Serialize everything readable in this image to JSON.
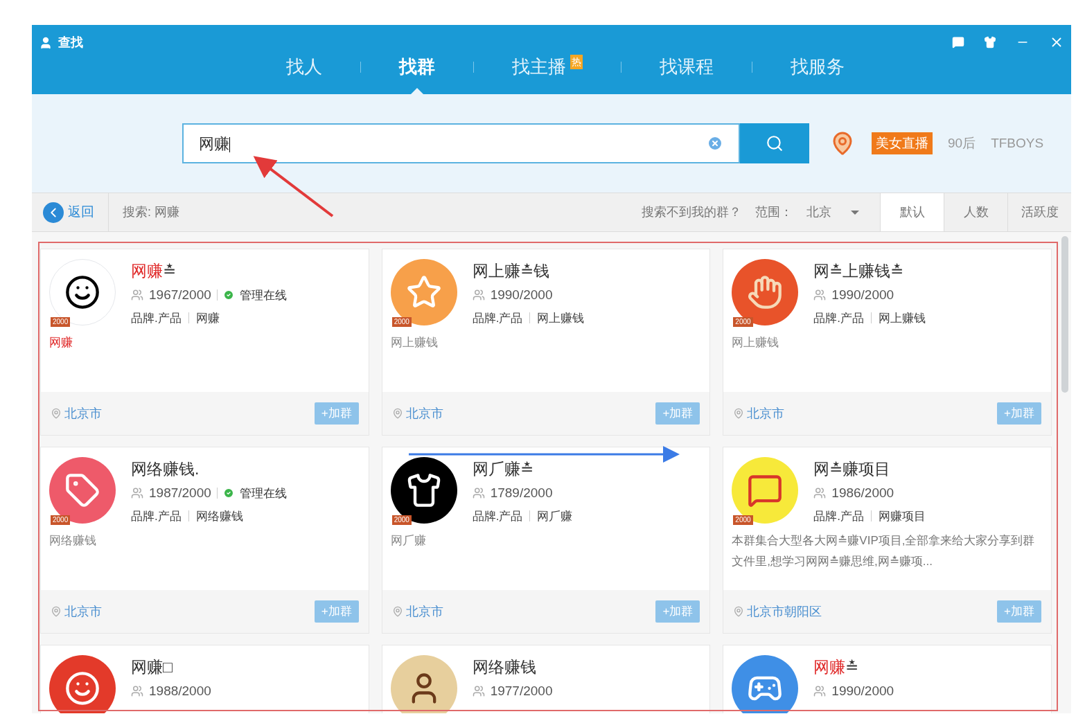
{
  "window": {
    "title": "查找"
  },
  "nav_tabs": [
    {
      "label": "找人",
      "selected": false
    },
    {
      "label": "找群",
      "selected": true
    },
    {
      "label": "找主播",
      "selected": false,
      "badge": "热"
    },
    {
      "label": "找课程",
      "selected": false
    },
    {
      "label": "找服务",
      "selected": false
    }
  ],
  "search": {
    "value": "网赚"
  },
  "hot_tags": [
    {
      "label": "美女直播",
      "kind": "highlight"
    },
    {
      "label": "90后",
      "kind": "plain"
    },
    {
      "label": "TFBOYS",
      "kind": "plain"
    }
  ],
  "toolbar": {
    "back": "返回",
    "query": "搜索: 网赚",
    "not_found": "搜索不到我的群？",
    "range_label": "范围：",
    "range_value": "北京",
    "sort_tabs": [
      {
        "label": "默认",
        "selected": true
      },
      {
        "label": "人数",
        "selected": false
      },
      {
        "label": "活跃度",
        "selected": false
      }
    ]
  },
  "groups": [
    {
      "kind": "panda",
      "level_badge": "2000",
      "name_parts": [
        {
          "text": "网赚",
          "match": true
        },
        {
          "text": "≛",
          "match": false
        }
      ],
      "members": "1967/2000",
      "admin_status": "管理在线",
      "tags": [
        "品牌.产品",
        "网赚"
      ],
      "keyword_parts": [
        {
          "text": "网赚",
          "match": true
        }
      ],
      "location": "北京市",
      "join": "+加群"
    },
    {
      "kind": "star",
      "level_badge": "2000",
      "name_parts": [
        {
          "text": "网上赚≛钱",
          "match": false
        }
      ],
      "members": "1990/2000",
      "tags": [
        "品牌.产品",
        "网上赚钱"
      ],
      "keyword_parts": [
        {
          "text": "网上赚钱",
          "match": false
        }
      ],
      "location": "北京市",
      "join": "+加群"
    },
    {
      "kind": "hand",
      "level_badge": "2000",
      "name_parts": [
        {
          "text": "网≛上赚钱≛",
          "match": false
        }
      ],
      "members": "1990/2000",
      "tags": [
        "品牌.产品",
        "网上赚钱"
      ],
      "keyword_parts": [
        {
          "text": "网上赚钱",
          "match": false
        }
      ],
      "location": "北京市",
      "join": "+加群"
    },
    {
      "kind": "tag",
      "level_badge": "2000",
      "name_parts": [
        {
          "text": "网络赚钱.",
          "match": false
        }
      ],
      "members": "1987/2000",
      "admin_status": "管理在线",
      "tags": [
        "品牌.产品",
        "网络赚钱"
      ],
      "keyword_parts": [
        {
          "text": "网络赚钱",
          "match": false
        }
      ],
      "location": "北京市",
      "join": "+加群"
    },
    {
      "kind": "dark",
      "level_badge": "2000",
      "name_parts": [
        {
          "text": "网⺁赚≛",
          "match": false
        }
      ],
      "members": "1789/2000",
      "tags": [
        "品牌.产品",
        "网⺁赚"
      ],
      "keyword_parts": [
        {
          "text": "网⺁赚",
          "match": false
        }
      ],
      "location": "北京市",
      "join": "+加群"
    },
    {
      "kind": "poster",
      "level_badge": "2000",
      "name_parts": [
        {
          "text": "网≛赚项目",
          "match": false
        }
      ],
      "members": "1986/2000",
      "tags": [
        "品牌.产品",
        "网赚项目"
      ],
      "description": "本群集合大型各大网≛赚VIP项目,全部拿来给大家分享到群文件里,想学习网网≛赚思维,网≛赚项...",
      "location": "北京市朝阳区",
      "join": "+加群"
    },
    {
      "kind": "mascot",
      "name_parts": [
        {
          "text": "网赚□",
          "match": false
        }
      ],
      "members": "1988/2000"
    },
    {
      "kind": "figure",
      "name_parts": [
        {
          "text": "网络赚钱",
          "match": false
        }
      ],
      "members": "1977/2000"
    },
    {
      "kind": "gamepad",
      "name_parts": [
        {
          "text": "网赚",
          "match": true
        },
        {
          "text": "≛",
          "match": false
        }
      ],
      "members": "1990/2000"
    }
  ]
}
